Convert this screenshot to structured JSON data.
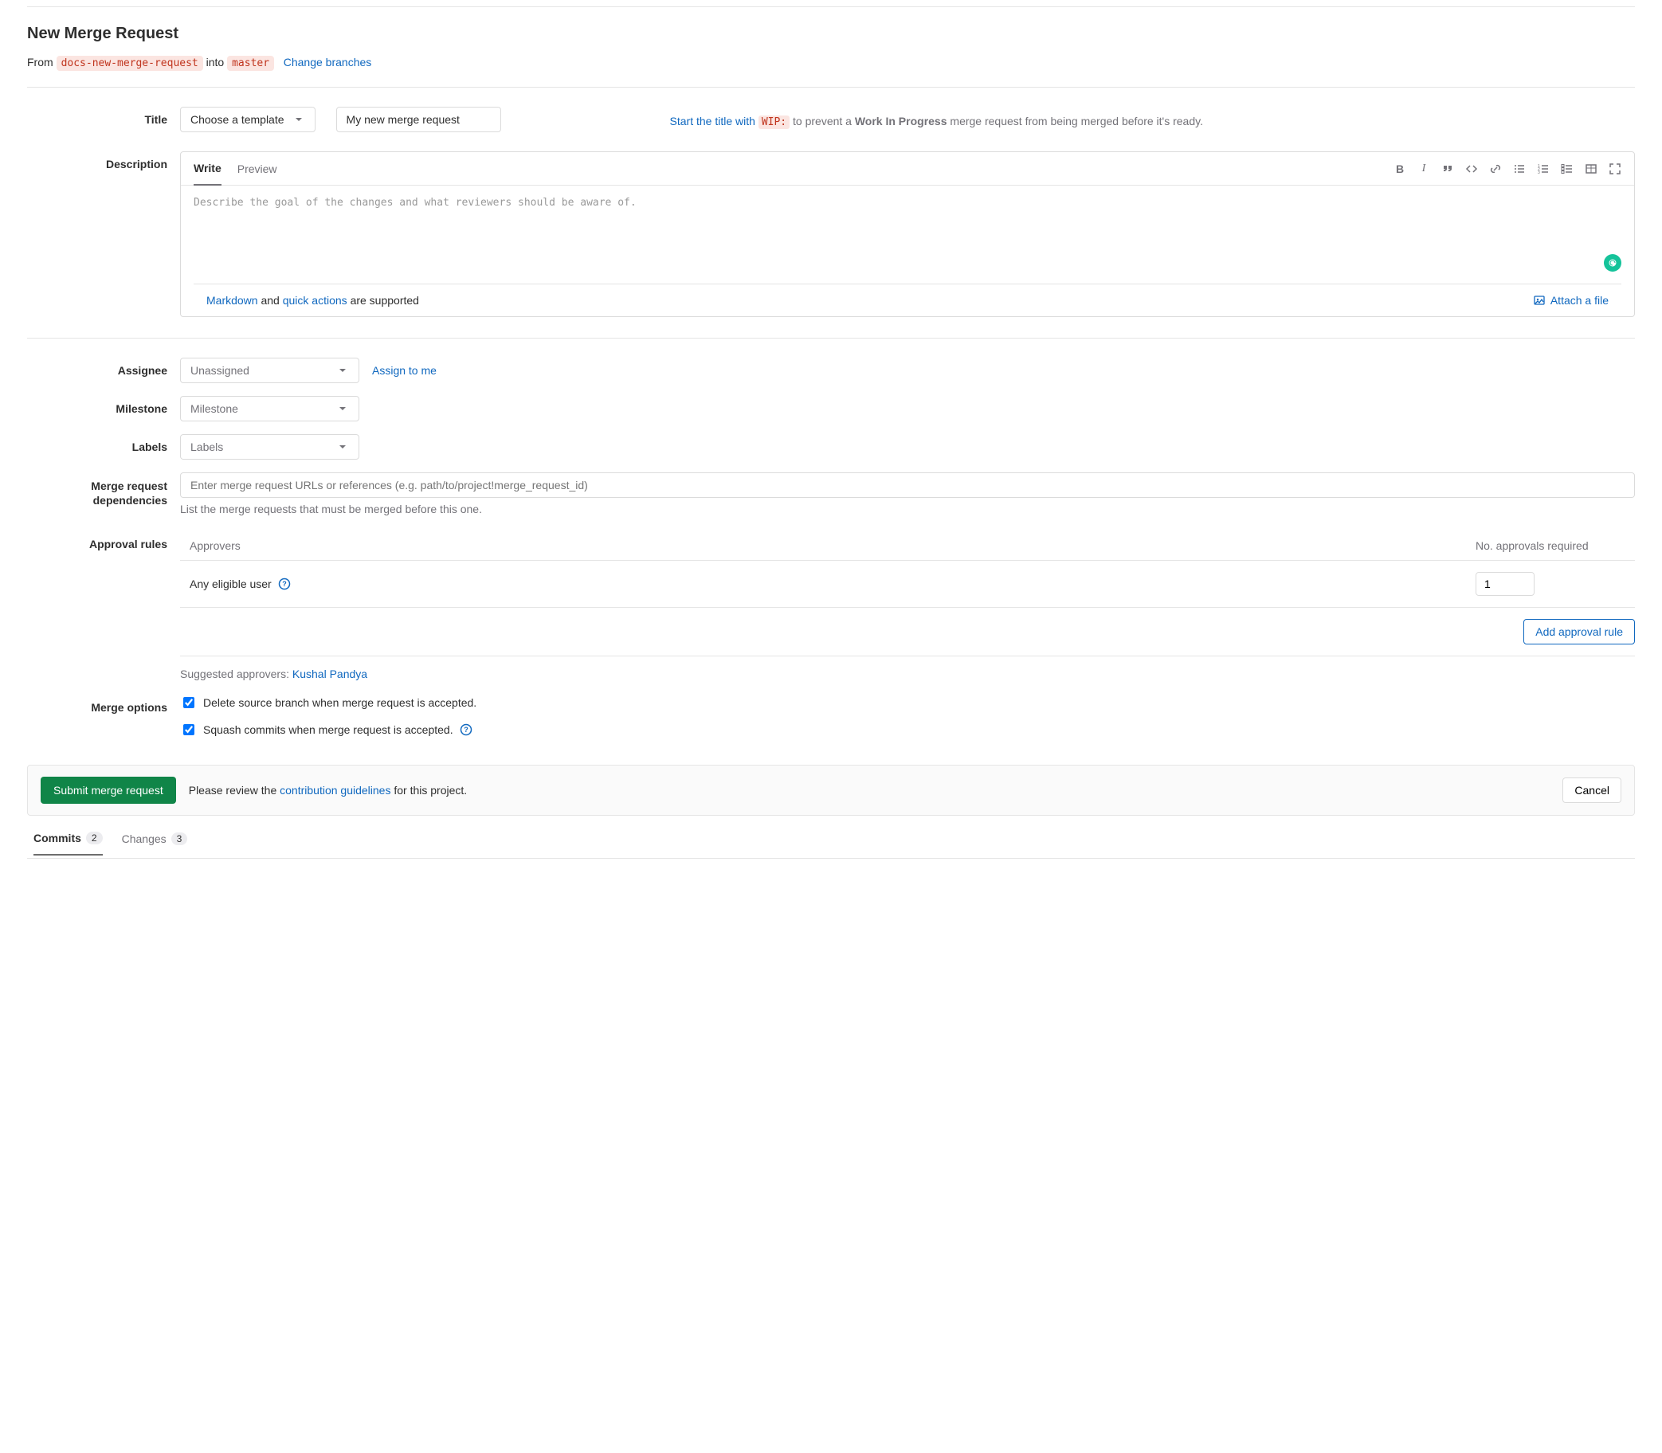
{
  "page": {
    "title": "New Merge Request"
  },
  "branches": {
    "from_label": "From",
    "source": "docs-new-merge-request",
    "into_label": "into",
    "target": "master",
    "change_link": "Change branches"
  },
  "title": {
    "label": "Title",
    "template_placeholder": "Choose a template",
    "value": "My new merge request",
    "wip_prefix_link": "Start the title with",
    "wip_code": "WIP:",
    "wip_help_mid": "to prevent a",
    "wip_bold": "Work In Progress",
    "wip_help_tail": "merge request from being merged before it's ready."
  },
  "description": {
    "label": "Description",
    "tab_write": "Write",
    "tab_preview": "Preview",
    "placeholder": "Describe the goal of the changes and what reviewers should be aware of.",
    "footer": {
      "markdown": "Markdown",
      "and": "and",
      "quick_actions": "quick actions",
      "supported": "are supported",
      "attach": "Attach a file"
    }
  },
  "assignee": {
    "label": "Assignee",
    "placeholder": "Unassigned",
    "assign_me": "Assign to me"
  },
  "milestone": {
    "label": "Milestone",
    "placeholder": "Milestone"
  },
  "labels": {
    "label": "Labels",
    "placeholder": "Labels"
  },
  "dependencies": {
    "label_line1": "Merge request",
    "label_line2": "dependencies",
    "placeholder": "Enter merge request URLs or references (e.g. path/to/project!merge_request_id)",
    "help": "List the merge requests that must be merged before this one."
  },
  "approval": {
    "label": "Approval rules",
    "col_approvers": "Approvers",
    "col_required": "No. approvals required",
    "any_eligible": "Any eligible user",
    "required_value": "1",
    "add_rule": "Add approval rule",
    "suggested_label": "Suggested approvers:",
    "suggested_name": "Kushal Pandya"
  },
  "merge_options": {
    "label": "Merge options",
    "delete_branch": "Delete source branch when merge request is accepted.",
    "squash": "Squash commits when merge request is accepted."
  },
  "footer": {
    "submit": "Submit merge request",
    "review_prefix": "Please review the",
    "guidelines": "contribution guidelines",
    "review_suffix": "for this project.",
    "cancel": "Cancel"
  },
  "tabs": {
    "commits": "Commits",
    "commits_count": "2",
    "changes": "Changes",
    "changes_count": "3"
  }
}
